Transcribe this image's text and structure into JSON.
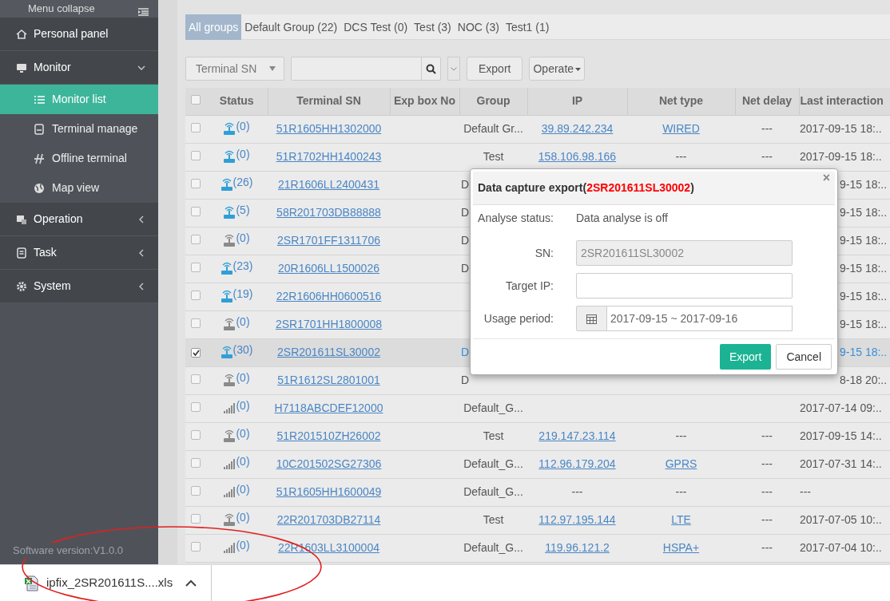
{
  "sidebar": {
    "collapse_label": "Menu collapse",
    "items": [
      {
        "label": "Personal panel"
      },
      {
        "label": "Monitor",
        "expanded": true,
        "children": [
          {
            "label": "Monitor list",
            "selected": true
          },
          {
            "label": "Terminal manage",
            "selected": false
          },
          {
            "label": "Offline terminal",
            "selected": false
          },
          {
            "label": "Map view",
            "selected": false
          }
        ]
      },
      {
        "label": "Operation",
        "expanded": false
      },
      {
        "label": "Task",
        "expanded": false
      },
      {
        "label": "System",
        "expanded": false
      }
    ],
    "version": "Software version:V1.0.0"
  },
  "group_tabs": [
    {
      "label": "All groups",
      "selected": true
    },
    {
      "label": "Default Group (22)",
      "selected": false
    },
    {
      "label": "DCS Test (0)",
      "selected": false
    },
    {
      "label": "Test (3)",
      "selected": false
    },
    {
      "label": "NOC (3)",
      "selected": false
    },
    {
      "label": "Test1 (1)",
      "selected": false
    }
  ],
  "toolbar": {
    "search_by": "Terminal SN",
    "buttons": [
      {
        "label": "Export",
        "kind": "plain"
      },
      {
        "label": "Operate",
        "kind": "dropdown"
      }
    ]
  },
  "table": {
    "select_all_checked": false,
    "columns": [
      "Status",
      "Terminal SN",
      "Exp box No",
      "Group",
      "IP",
      "Net type",
      "Net delay",
      "Last interaction"
    ],
    "rows": [
      {
        "checked": false,
        "selected": false,
        "status": {
          "kind": "router",
          "online": true,
          "count": "(0)"
        },
        "sn": "51R1605HH1302000",
        "group": "Default Gr...",
        "ip": "39.89.242.234",
        "net_type": "WIRED",
        "net_delay": "---",
        "last": "2017-09-15 18:.."
      },
      {
        "checked": false,
        "selected": false,
        "status": {
          "kind": "router",
          "online": true,
          "count": "(0)"
        },
        "sn": "51R1702HH1400243",
        "group": "Test",
        "ip": "158.106.98.166",
        "net_type": "---",
        "net_delay": "---",
        "last": "2017-09-15 18:.."
      },
      {
        "checked": false,
        "selected": false,
        "status": {
          "kind": "router",
          "online": true,
          "count": "(26)"
        },
        "sn": "21R1606LL2400431",
        "group": "D",
        "last": "9-15 18:.."
      },
      {
        "checked": false,
        "selected": false,
        "status": {
          "kind": "router",
          "online": true,
          "count": "(5)"
        },
        "sn": "58R201703DB88888",
        "group": "D",
        "last": "9-15 18:.."
      },
      {
        "checked": false,
        "selected": false,
        "status": {
          "kind": "router",
          "online": false,
          "count": "(0)"
        },
        "sn": "2SR1701FF1311706",
        "group": "D",
        "last": "9-15 18:.."
      },
      {
        "checked": false,
        "selected": false,
        "status": {
          "kind": "router",
          "online": true,
          "count": "(23)"
        },
        "sn": "20R1606LL1500026",
        "group": "D",
        "last": "9-15 18:.."
      },
      {
        "checked": false,
        "selected": false,
        "status": {
          "kind": "router",
          "online": true,
          "count": "(19)"
        },
        "sn": "22R1606HH0600516",
        "last": "9-15 18:.."
      },
      {
        "checked": false,
        "selected": false,
        "status": {
          "kind": "router",
          "online": false,
          "count": "(0)"
        },
        "sn": "2SR1701HH1800008",
        "last": "9-15 18:.."
      },
      {
        "checked": true,
        "selected": true,
        "status": {
          "kind": "router",
          "online": true,
          "count": "(30)"
        },
        "sn": "2SR201611SL30002",
        "group": "D",
        "last": "9-15 18:.."
      },
      {
        "checked": false,
        "selected": false,
        "status": {
          "kind": "router",
          "online": false,
          "count": "(0)"
        },
        "sn": "51R1612SL2801001",
        "group": "D",
        "last": "8-18 20:.."
      },
      {
        "checked": false,
        "selected": false,
        "status": {
          "kind": "bars",
          "online": false,
          "count": "(0)"
        },
        "sn": "H7118ABCDEF12000",
        "group": "Default_G...",
        "last": "2017-07-14 09:.."
      },
      {
        "checked": false,
        "selected": false,
        "status": {
          "kind": "router",
          "online": false,
          "count": "(0)"
        },
        "sn": "51R201510ZH26002",
        "group": "Test",
        "ip": "219.147.23.114",
        "net_type": "---",
        "net_delay": "---",
        "last": "2017-09-15 14:.."
      },
      {
        "checked": false,
        "selected": false,
        "status": {
          "kind": "bars",
          "online": false,
          "count": "(0)"
        },
        "sn": "10C201502SG27306",
        "group": "Default_G...",
        "ip": "112.96.179.204",
        "net_type": "GPRS",
        "net_delay": "---",
        "last": "2017-07-31 14:.."
      },
      {
        "checked": false,
        "selected": false,
        "status": {
          "kind": "bars",
          "online": false,
          "count": "(0)"
        },
        "sn": "51R1605HH1600049",
        "group": "Default_G...",
        "ip": "---",
        "net_type": "---",
        "net_delay": "---",
        "last": "---"
      },
      {
        "checked": false,
        "selected": false,
        "status": {
          "kind": "router",
          "online": false,
          "count": "(0)"
        },
        "sn": "22R201703DB27114",
        "group": "Test",
        "ip": "112.97.195.144",
        "net_type": "LTE",
        "net_delay": "---",
        "last": "2017-07-05 10:.."
      },
      {
        "checked": false,
        "selected": false,
        "status": {
          "kind": "bars",
          "online": false,
          "count": "(0)"
        },
        "sn": "22R1603LL3100004",
        "group": "Default_G...",
        "ip": "119.96.121.2",
        "net_type": "HSPA+",
        "net_delay": "---",
        "last": "2017-07-04 10:.."
      }
    ]
  },
  "dialog": {
    "title": "Data capture export(",
    "title_sn": "2SR201611SL30002",
    "title_end": ")",
    "close": "×",
    "fields": [
      {
        "kind": "text",
        "label": "Analyse status:",
        "value": "Data analyse is off"
      },
      {
        "kind": "input",
        "label": "SN:",
        "value": "2SR201611SL30002",
        "disabled": true
      },
      {
        "kind": "input",
        "label": "Target IP:",
        "disabled": false
      },
      {
        "kind": "date",
        "label": "Usage period:",
        "value": "2017-09-15 ~ 2017-09-16"
      }
    ],
    "buttons": [
      {
        "label": "Export",
        "kind": "primary"
      },
      {
        "label": "Cancel",
        "kind": "default"
      }
    ]
  },
  "download": {
    "file": "ipfix_2SR201611S....xls"
  }
}
